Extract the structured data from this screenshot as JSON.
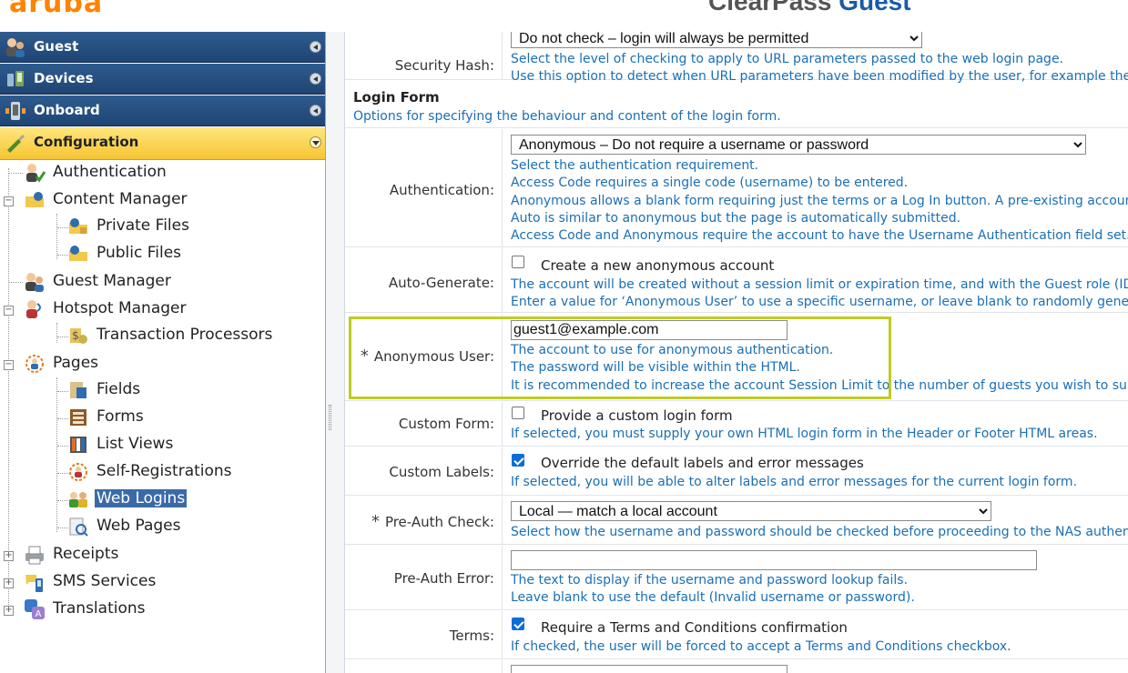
{
  "header": {
    "logo_text": "aruba",
    "product_part1": "ClearPass",
    "product_part2": "Guest"
  },
  "sidebar": {
    "sections": [
      {
        "label": "Guest",
        "icon": "guest-icon"
      },
      {
        "label": "Devices",
        "icon": "devices-icon"
      },
      {
        "label": "Onboard",
        "icon": "onboard-icon"
      },
      {
        "label": "Configuration",
        "icon": "configuration-icon"
      }
    ],
    "tree": [
      {
        "label": "Authentication",
        "icon": "authentication-icon"
      },
      {
        "label": "Content Manager",
        "icon": "content-manager-icon"
      },
      {
        "label": "Private Files",
        "icon": "private-files-icon"
      },
      {
        "label": "Public Files",
        "icon": "public-files-icon"
      },
      {
        "label": "Guest Manager",
        "icon": "guest-manager-icon"
      },
      {
        "label": "Hotspot Manager",
        "icon": "hotspot-manager-icon"
      },
      {
        "label": "Transaction Processors",
        "icon": "transaction-processors-icon"
      },
      {
        "label": "Pages",
        "icon": "pages-icon"
      },
      {
        "label": "Fields",
        "icon": "fields-icon"
      },
      {
        "label": "Forms",
        "icon": "forms-icon"
      },
      {
        "label": "List Views",
        "icon": "list-views-icon"
      },
      {
        "label": "Self-Registrations",
        "icon": "self-registrations-icon"
      },
      {
        "label": "Web Logins",
        "icon": "web-logins-icon",
        "selected": true
      },
      {
        "label": "Web Pages",
        "icon": "web-pages-icon"
      },
      {
        "label": "Receipts",
        "icon": "receipts-icon"
      },
      {
        "label": "SMS Services",
        "icon": "sms-services-icon"
      },
      {
        "label": "Translations",
        "icon": "translations-icon"
      }
    ]
  },
  "form": {
    "security_hash": {
      "label": "Security Hash:",
      "select_value": "Do not check – login will always be permitted",
      "help": [
        "Select the level of checking to apply to URL parameters passed to the web login page.",
        "Use this option to detect when URL parameters have been modified by the user, for example their"
      ]
    },
    "login_form_section": {
      "title": "Login Form",
      "subtitle": "Options for specifying the behaviour and content of the login form."
    },
    "authentication": {
      "label": "Authentication:",
      "select_value": "Anonymous – Do not require a username or password",
      "help": [
        "Select the authentication requirement.",
        "Access Code requires a single code (username) to be entered.",
        "Anonymous allows a blank form requiring just the terms or a Log In button. A pre-existing accoun",
        "Auto is similar to anonymous but the page is automatically submitted.",
        "Access Code and Anonymous require the account to have the Username Authentication field set."
      ]
    },
    "auto_generate": {
      "label": "Auto-Generate:",
      "checkbox_label": "Create a new anonymous account",
      "checked": false,
      "help": [
        "The account will be created without a session limit or expiration time, and with the Guest role (ID",
        "Enter a value for ‘Anonymous User’ to use a specific username, or leave blank to randomly genera"
      ]
    },
    "anonymous_user": {
      "required_mark": "*",
      "label": "Anonymous User:",
      "value": "guest1@example.com",
      "help": [
        "The account to use for anonymous authentication.",
        "The password will be visible within the HTML.",
        "It is recommended to increase the account Session Limit to the number of guests you wish to sup"
      ]
    },
    "custom_form": {
      "label": "Custom Form:",
      "checkbox_label": "Provide a custom login form",
      "checked": false,
      "help": [
        "If selected, you must supply your own HTML login form in the Header or Footer HTML areas."
      ]
    },
    "custom_labels": {
      "label": "Custom Labels:",
      "checkbox_label": "Override the default labels and error messages",
      "checked": true,
      "help": [
        "If selected, you will be able to alter labels and error messages for the current login form."
      ]
    },
    "pre_auth_check": {
      "required_mark": "*",
      "label": "Pre-Auth Check:",
      "select_value": "Local — match a local account",
      "help": [
        "Select how the username and password should be checked before proceeding to the NAS authenti"
      ]
    },
    "pre_auth_error": {
      "label": "Pre-Auth Error:",
      "value": "",
      "help": [
        "The text to display if the username and password lookup fails.",
        "Leave blank to use the default (Invalid username or password)."
      ]
    },
    "terms": {
      "label": "Terms:",
      "checkbox_label": "Require a Terms and Conditions confirmation",
      "checked": true,
      "help": [
        "If checked, the user will be forced to accept a Terms and Conditions checkbox."
      ]
    }
  },
  "colors": {
    "brand_orange": "#ff8300",
    "nav_blue": "#1e4573",
    "active_yellow": "#f7c531",
    "help_blue": "#1b6fb5",
    "highlight_box": "#c0cc22",
    "selected_item": "#3b6aa8"
  }
}
